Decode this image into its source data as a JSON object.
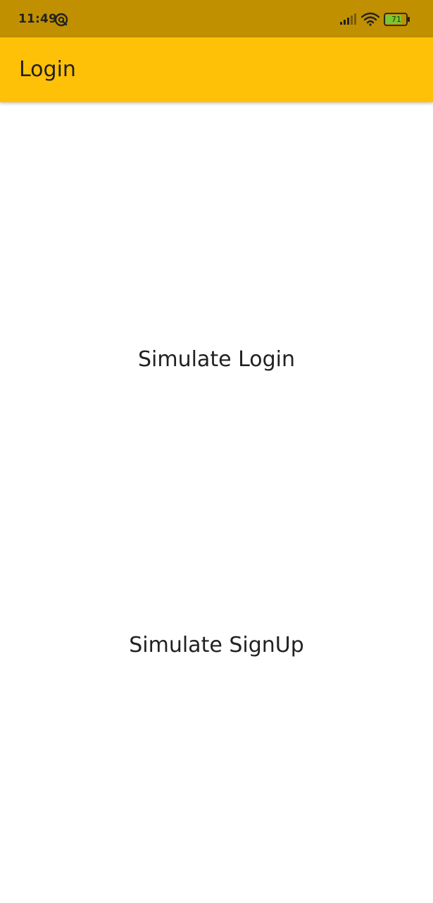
{
  "status_bar": {
    "time": "11:49",
    "battery_level": "71",
    "icons": [
      "sync-icon",
      "signal-icon",
      "wifi-icon",
      "battery-icon"
    ],
    "background_color": "#c09000"
  },
  "app_bar": {
    "title": "Login",
    "background_color": "#ffc107"
  },
  "actions": {
    "login_label": "Simulate Login",
    "signup_label": "Simulate SignUp"
  }
}
